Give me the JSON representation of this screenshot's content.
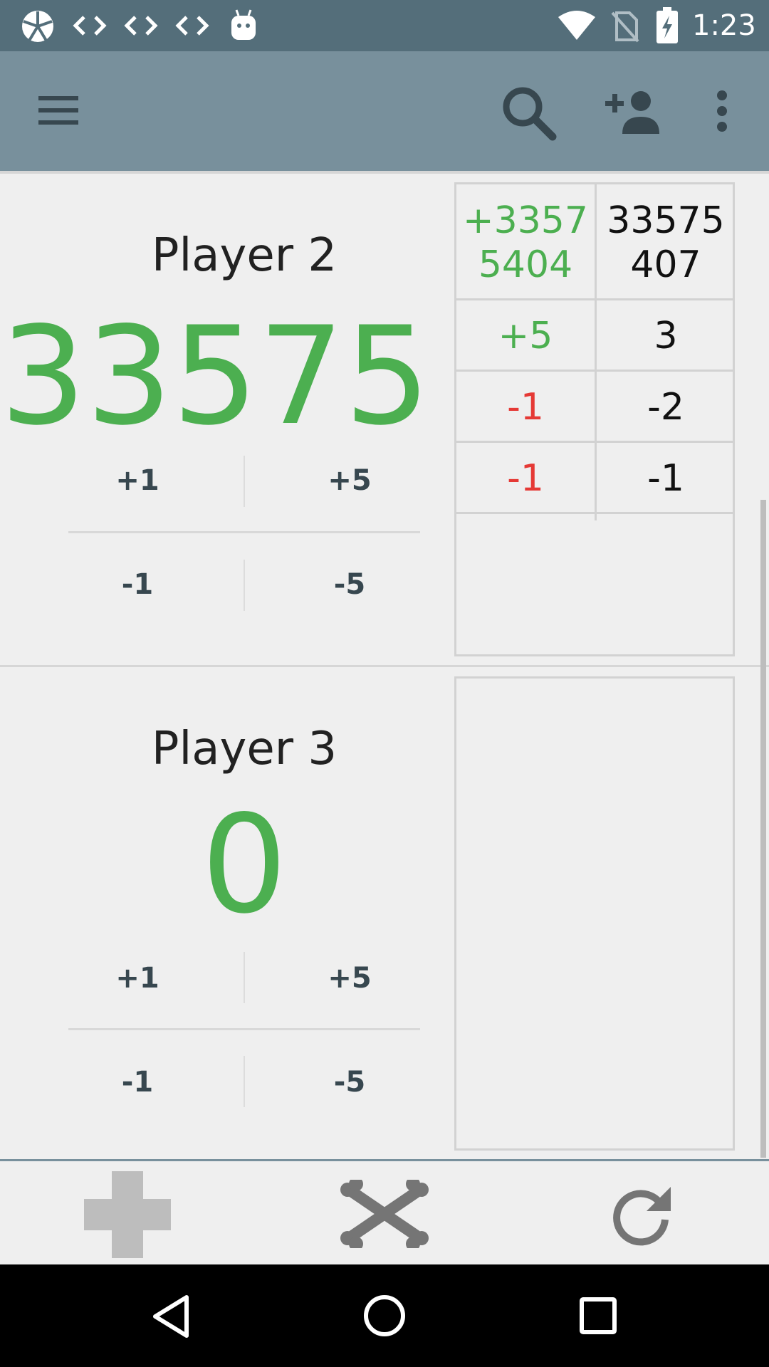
{
  "status_bar": {
    "time": "1:23",
    "icons": [
      "app-logo-icon",
      "code-icon",
      "code-icon",
      "code-icon",
      "android-icon",
      "wifi-icon",
      "no-sim-icon",
      "battery-charging-icon"
    ]
  },
  "app_bar": {
    "icons": [
      "menu-icon",
      "search-icon",
      "add-person-icon",
      "more-vert-icon"
    ]
  },
  "players": [
    {
      "name": "Player 2",
      "score": "33575",
      "buttons": {
        "plus_one": "+1",
        "plus_five": "+5",
        "minus_one": "-1",
        "minus_five": "-5"
      },
      "history": [
        {
          "delta": "+3357\n5404",
          "total": "33575\n407",
          "color": "green"
        },
        {
          "delta": "+5",
          "total": "3",
          "color": "green"
        },
        {
          "delta": "-1",
          "total": "-2",
          "color": "red"
        },
        {
          "delta": "-1",
          "total": "-1",
          "color": "red"
        }
      ]
    },
    {
      "name": "Player 3",
      "score": "0",
      "buttons": {
        "plus_one": "+1",
        "plus_five": "+5",
        "minus_one": "-1",
        "minus_five": "-5"
      },
      "history": []
    }
  ],
  "bottom_toolbar": {
    "icons": [
      "add-icon",
      "crossbones-icon",
      "refresh-icon"
    ]
  },
  "nav_bar": {
    "icons": [
      "back-icon",
      "home-icon",
      "recents-icon"
    ]
  },
  "colors": {
    "status_bar": "#546e7a",
    "app_bar": "#78909c",
    "positive": "#4caf50",
    "negative": "#e53935",
    "background": "#efefef"
  }
}
